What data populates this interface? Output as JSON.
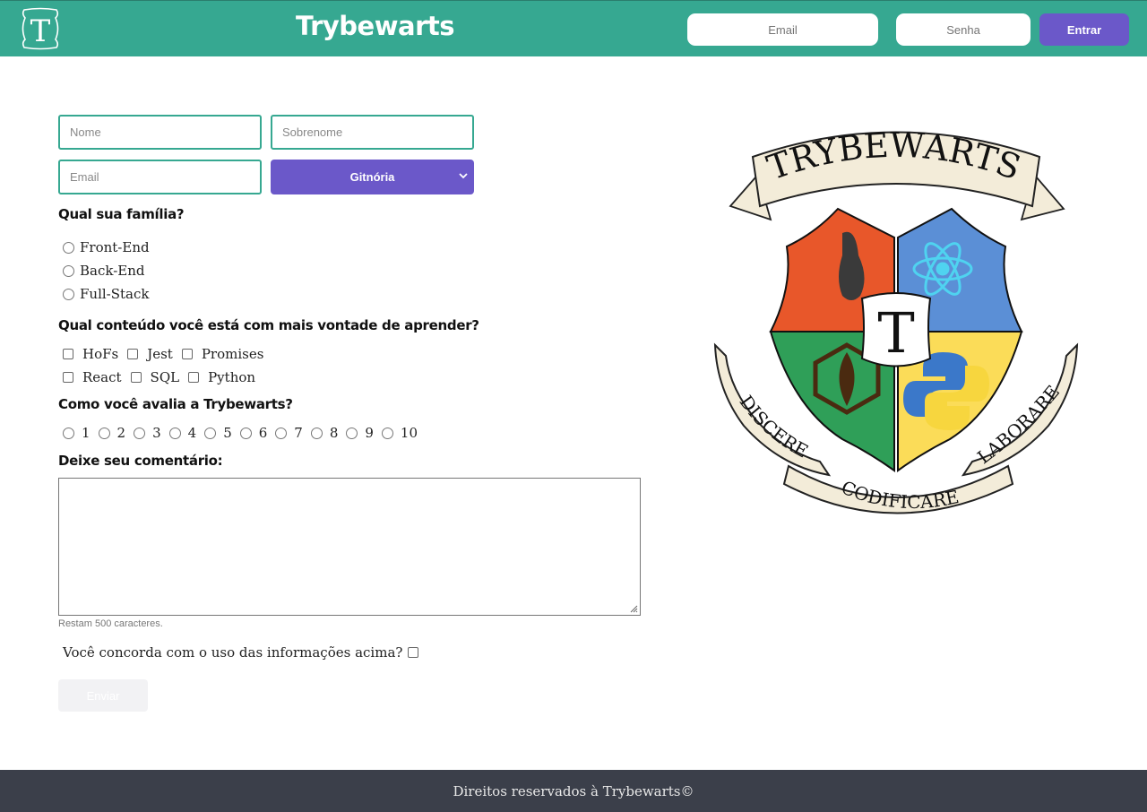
{
  "header": {
    "title": "Trybewarts",
    "logo_letter": "T",
    "login": {
      "email_placeholder": "Email",
      "password_placeholder": "Senha",
      "button": "Entrar"
    }
  },
  "form": {
    "name_placeholder": "Nome",
    "lastname_placeholder": "Sobrenome",
    "email_placeholder": "Email",
    "house_selected": "Gitnória",
    "family": {
      "question": "Qual sua família?",
      "options": [
        "Front-End",
        "Back-End",
        "Full-Stack"
      ]
    },
    "content": {
      "question": "Qual conteúdo você está com mais vontade de aprender?",
      "options_row1": [
        "HoFs",
        "Jest",
        "Promises"
      ],
      "options_row2": [
        "React",
        "SQL",
        "Python"
      ]
    },
    "rate": {
      "question": "Como você avalia a Trybewarts?",
      "options": [
        "1",
        "2",
        "3",
        "4",
        "5",
        "6",
        "7",
        "8",
        "9",
        "10"
      ]
    },
    "comment": {
      "label": "Deixe seu comentário:",
      "counter": "Restam 500 caracteres."
    },
    "agreement": "Você concorda com o uso das informações acima?",
    "submit": "Enviar"
  },
  "crest": {
    "banner_top": "TRYBEWARTS",
    "center_letter": "T",
    "motto_left": "DISCERE",
    "motto_bottom": "CODIFICARE",
    "motto_right": "LABORARE",
    "colors": {
      "red": "#e8572a",
      "blue": "#5b8fd6",
      "green": "#2f9f58",
      "yellow": "#fbdc58",
      "ribbon": "#f3ecd9"
    }
  },
  "footer": {
    "text": "Direitos reservados à Trybewarts©"
  },
  "theme": {
    "primary": "#36a891",
    "accent": "#6b58c9",
    "footer_bg": "#3b3f4a"
  }
}
